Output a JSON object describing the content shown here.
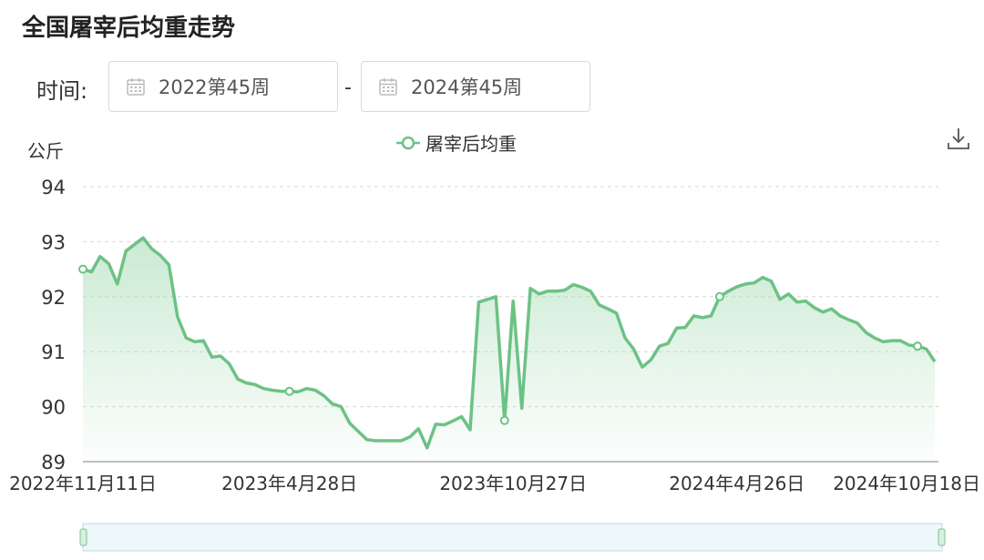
{
  "title": "全国屠宰后均重走势",
  "filter": {
    "label": "时间:",
    "start": "2022第45周",
    "separator": "-",
    "end": "2024第45周"
  },
  "colors": {
    "line": "#6cc285",
    "fill_top": "#9fd9ae",
    "grid": "#d6d6d6",
    "slider_fill": "#eef7fa",
    "slider_border": "#c6d7e0"
  },
  "chart_data": {
    "type": "area",
    "title": "全国屠宰后均重走势",
    "ylabel": "公斤",
    "ylim": [
      89,
      94
    ],
    "yticks": [
      89,
      90,
      91,
      92,
      93,
      94
    ],
    "xtick_labels": [
      "2022年11月11日",
      "2023年4月28日",
      "2023年10月27日",
      "2024年4月26日",
      "2024年10月18日"
    ],
    "xtick_index": [
      0,
      24,
      50,
      76,
      102
    ],
    "legend": {
      "position": "top-center"
    },
    "grid": true,
    "series": [
      {
        "name": "屠宰后均重",
        "values": [
          92.5,
          92.45,
          92.73,
          92.6,
          92.23,
          92.83,
          92.95,
          93.07,
          92.87,
          92.75,
          92.58,
          91.63,
          91.25,
          91.18,
          91.2,
          90.9,
          90.92,
          90.78,
          90.5,
          90.43,
          90.4,
          90.33,
          90.3,
          90.28,
          90.28,
          90.27,
          90.33,
          90.3,
          90.2,
          90.05,
          90.0,
          89.7,
          89.55,
          89.4,
          89.38,
          89.38,
          89.38,
          89.38,
          89.45,
          89.6,
          89.25,
          89.68,
          89.67,
          89.74,
          89.82,
          89.58,
          91.9,
          91.95,
          92.0,
          89.75,
          91.92,
          89.97,
          92.15,
          92.05,
          92.1,
          92.1,
          92.12,
          92.22,
          92.17,
          92.1,
          91.85,
          91.78,
          91.7,
          91.25,
          91.05,
          90.72,
          90.85,
          91.1,
          91.15,
          91.43,
          91.44,
          91.65,
          91.62,
          91.65,
          92.0,
          92.1,
          92.18,
          92.23,
          92.25,
          92.35,
          92.28,
          91.95,
          92.05,
          91.9,
          91.92,
          91.8,
          91.72,
          91.78,
          91.65,
          91.58,
          91.52,
          91.35,
          91.25,
          91.18,
          91.2,
          91.2,
          91.12,
          91.1,
          91.05,
          90.82
        ]
      }
    ],
    "marked_points": [
      0,
      24,
      49,
      74,
      97
    ]
  }
}
